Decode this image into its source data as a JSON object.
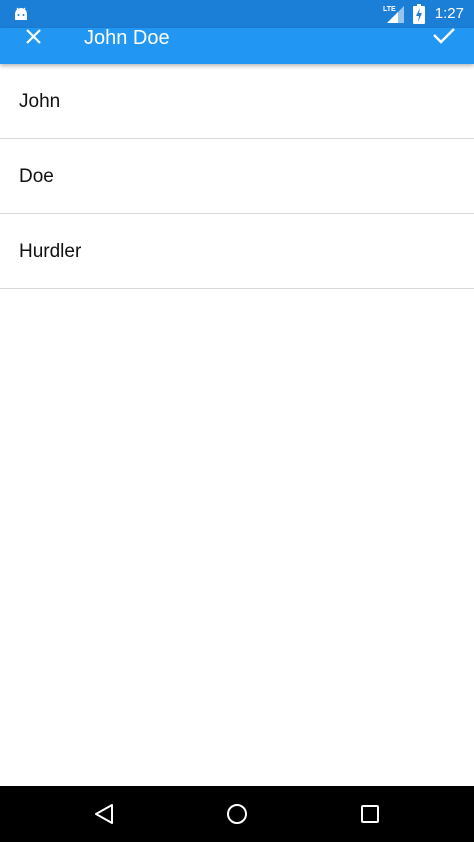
{
  "status_bar": {
    "network": "LTE",
    "time": "1:27"
  },
  "app_bar": {
    "title": "John Doe"
  },
  "list": {
    "items": [
      {
        "label": "John"
      },
      {
        "label": "Doe"
      },
      {
        "label": "Hurdler"
      }
    ]
  },
  "nav_bar": {
    "buttons": [
      "back-icon",
      "home-icon",
      "recents-icon"
    ]
  },
  "colors": {
    "status_bar": "#1c7fd7",
    "app_bar": "#2196f3",
    "nav_bar": "#000000",
    "divider": "#d9d9d9"
  }
}
